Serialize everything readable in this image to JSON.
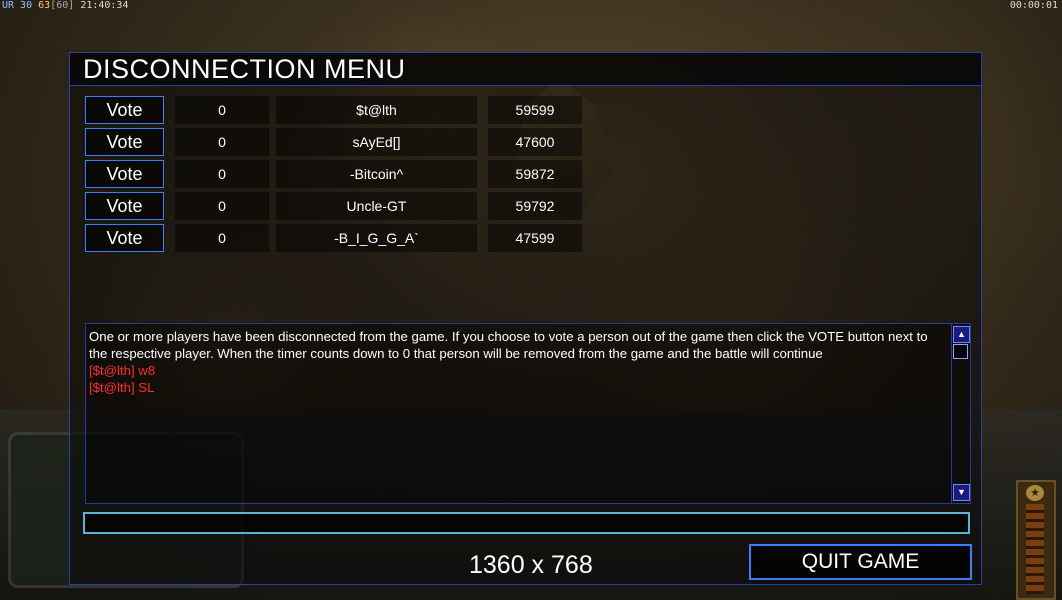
{
  "hud": {
    "top_left": {
      "part_a": "UR 30",
      "part_b": "63",
      "part_c": "[60]",
      "time": "21:40:34"
    },
    "top_right": "00:00:01"
  },
  "menu": {
    "title": "DISCONNECTION MENU",
    "players": [
      {
        "vote_label": "Vote",
        "count": "0",
        "name": "$t@lth",
        "id": "59599"
      },
      {
        "vote_label": "Vote",
        "count": "0",
        "name": "sAyEd[]",
        "id": "47600"
      },
      {
        "vote_label": "Vote",
        "count": "0",
        "name": "-Bitcoin^",
        "id": "59872"
      },
      {
        "vote_label": "Vote",
        "count": "0",
        "name": "Uncle-GT",
        "id": "59792"
      },
      {
        "vote_label": "Vote",
        "count": "0",
        "name": "-B_I_G_G_A`",
        "id": "47599"
      }
    ],
    "messages": {
      "system": "One or more players have been disconnected from the game. If you choose to vote a person out of the game then click the VOTE button next to the respective player. When the timer counts down to 0 that person will be removed from the game and the battle will continue",
      "chat": [
        "[$t@lth] w8",
        "[$t@lth] SL"
      ]
    },
    "chat_input": {
      "value": "",
      "placeholder": ""
    },
    "resolution": "1360 x 768",
    "quit_label": "QUIT GAME"
  },
  "colors": {
    "accent_border": "#3c7cff",
    "chat_text": "#ff2a2a",
    "input_border": "#5ab4d8"
  }
}
